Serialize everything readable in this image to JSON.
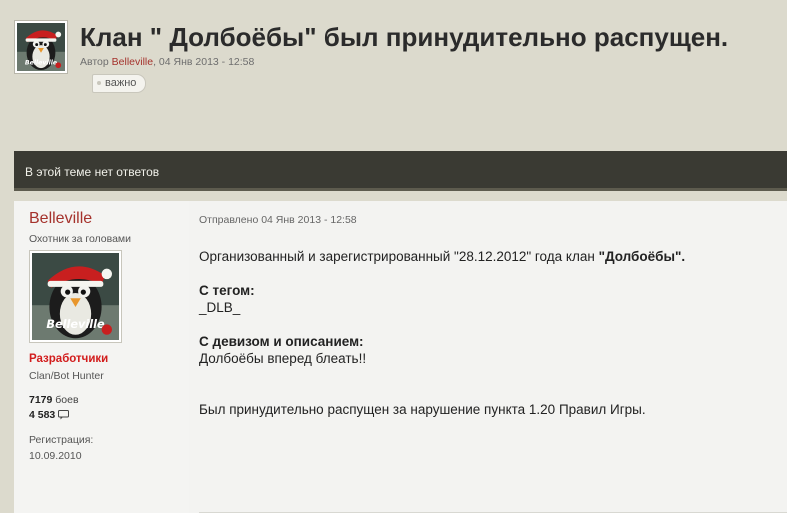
{
  "topic": {
    "title": "Клан \" Долбоёбы\" был принудительно распущен.",
    "meta_prefix": "Автор",
    "author": "Belleville",
    "meta_date": ", 04 Янв 2013 - 12:58",
    "tag": "важно"
  },
  "bar": {
    "text": "В этой теме нет ответов"
  },
  "post": {
    "author": {
      "name": "Belleville",
      "rank": "Охотник за головами",
      "group": "Разработчики",
      "title": "Clan/Bot Hunter",
      "battles_count": "7179",
      "battles_label": " боев",
      "posts_count": "4 583",
      "reg_label": "Регистрация:",
      "reg_date": "10.09.2010",
      "avatar_text": "Belleville"
    },
    "date": "Отправлено 04 Янв 2013 - 12:58",
    "line1_a": "Организованный и зарегистрированный \"28.12.2012\"  года клан ",
    "line1_b": "\"Долбоёбы\".",
    "tag_label": "С тегом:",
    "tag_value": "_DLB_",
    "motto_label": "С девизом и описанием:",
    "motto_value": "Долбоёбы вперед блеать!!",
    "closing": "Был принудительно распущен за нарушение пункта 1.20 Правил Игры."
  },
  "colors": {
    "background": "#dcdacd",
    "bar": "#3a3a33",
    "author_link": "#a5322c",
    "group_red": "#d21c1c"
  }
}
